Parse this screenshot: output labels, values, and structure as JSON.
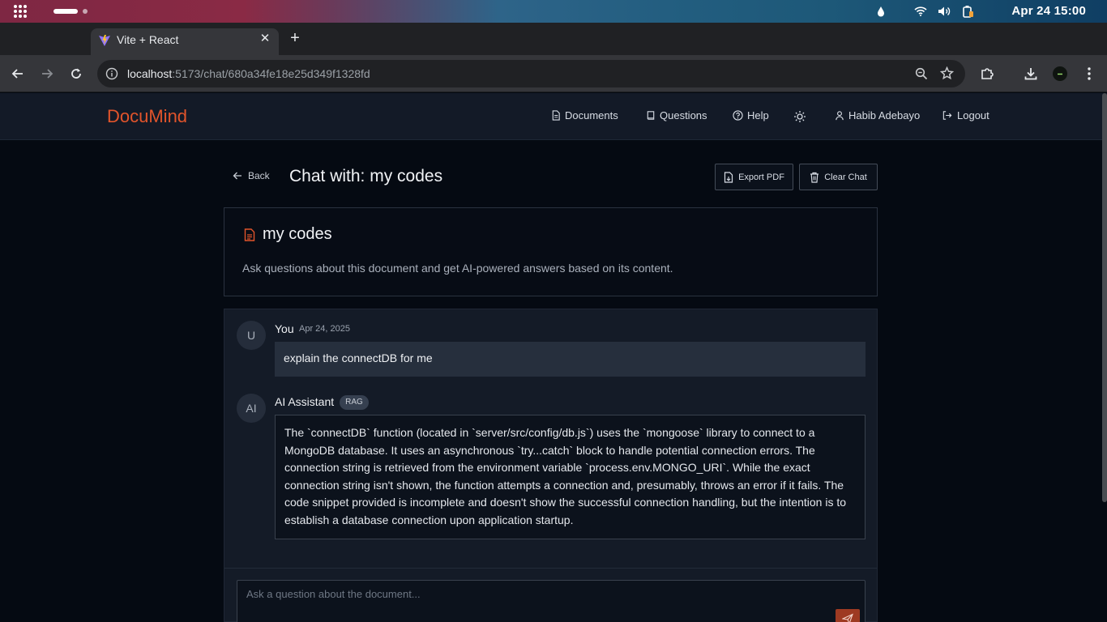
{
  "os": {
    "clock": "Apr 24  15:00"
  },
  "browser": {
    "tab_title": "Vite + React",
    "url_host": "localhost",
    "url_rest": ":5173/chat/680a34fe18e25d349f1328fd"
  },
  "app": {
    "logo": "DocuMind",
    "nav": {
      "documents": "Documents",
      "questions": "Questions",
      "help": "Help",
      "user": "Habib Adebayo",
      "logout": "Logout"
    }
  },
  "chat": {
    "back_label": "Back",
    "title": "Chat with: my codes",
    "export_label": "Export PDF",
    "clear_label": "Clear Chat"
  },
  "document": {
    "name": "my codes",
    "description": "Ask questions about this document and get AI-powered answers based on its content."
  },
  "messages": [
    {
      "avatar": "U",
      "author": "You",
      "date": "Apr 24, 2025",
      "text": "explain the connectDB for me"
    },
    {
      "avatar": "AI",
      "author": "AI Assistant",
      "badge": "RAG",
      "text": "The `connectDB` function (located in `server/src/config/db.js`) uses the `mongoose` library to connect to a MongoDB database. It uses an asynchronous `try...catch` block to handle potential connection errors. The connection string is retrieved from the environment variable `process.env.MONGO_URI`. While the exact connection string isn't shown, the function attempts a connection and, presumably, throws an error if it fails. The code snippet provided is incomplete and doesn't show the successful connection handling, but the intention is to establish a database connection upon application startup."
    }
  ],
  "input": {
    "placeholder": "Ask a question about the document..."
  },
  "colors": {
    "accent": "#e2542b",
    "send_button": "#9e3a22"
  }
}
